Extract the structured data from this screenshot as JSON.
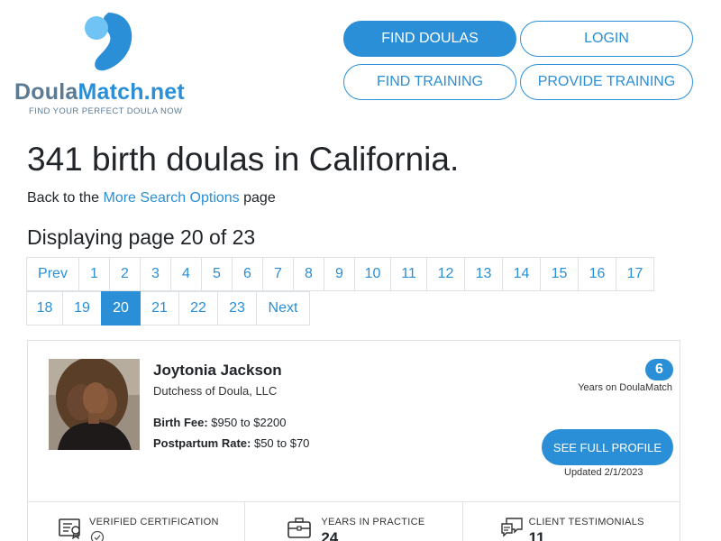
{
  "header": {
    "logo_text_part1": "Doula",
    "logo_text_part2": "Match.net",
    "logo_tagline": "FIND YOUR PERFECT DOULA NOW",
    "nav": {
      "find_doulas": "FIND DOULAS",
      "login": "LOGIN",
      "find_training": "FIND TRAINING",
      "provide_training": "PROVIDE TRAINING"
    }
  },
  "main": {
    "title": "341 birth doulas in California.",
    "back_prefix": "Back to the ",
    "back_link": "More Search Options",
    "back_suffix": " page",
    "displaying": "Displaying page 20 of 23"
  },
  "pagination": {
    "current": "20",
    "row1": [
      "Prev",
      "1",
      "2",
      "3",
      "4",
      "5",
      "6",
      "7",
      "8",
      "9",
      "10",
      "11",
      "12",
      "13",
      "14",
      "15",
      "16",
      "17"
    ],
    "row2": [
      "18",
      "19",
      "20",
      "21",
      "22",
      "23",
      "Next"
    ]
  },
  "card": {
    "name": "Joytonia Jackson",
    "company": "Dutchess of Doula, LLC",
    "birth_fee_label": "Birth Fee:",
    "birth_fee_value": " $950 to $2200",
    "postpartum_label": "Postpartum Rate:",
    "postpartum_value": " $50 to $70",
    "years_on_site": "6",
    "years_on_site_label": "Years on DoulaMatch",
    "profile_button": "SEE FULL PROFILE",
    "updated": "Updated 2/1/2023",
    "stats": {
      "certification_label": "VERIFIED CERTIFICATION",
      "years_label": "YEARS IN PRACTICE",
      "years_value": "24",
      "testimonials_label": "CLIENT TESTIMONIALS",
      "testimonials_value": "11"
    }
  },
  "colors": {
    "accent": "#2a8fd6",
    "logo_gray": "#5b7a94"
  },
  "icons": {
    "logo": "doulamatch-logo-icon",
    "certification": "certificate-icon",
    "years": "briefcase-icon",
    "testimonials": "chat-bubbles-icon",
    "check": "check-circle-icon"
  }
}
